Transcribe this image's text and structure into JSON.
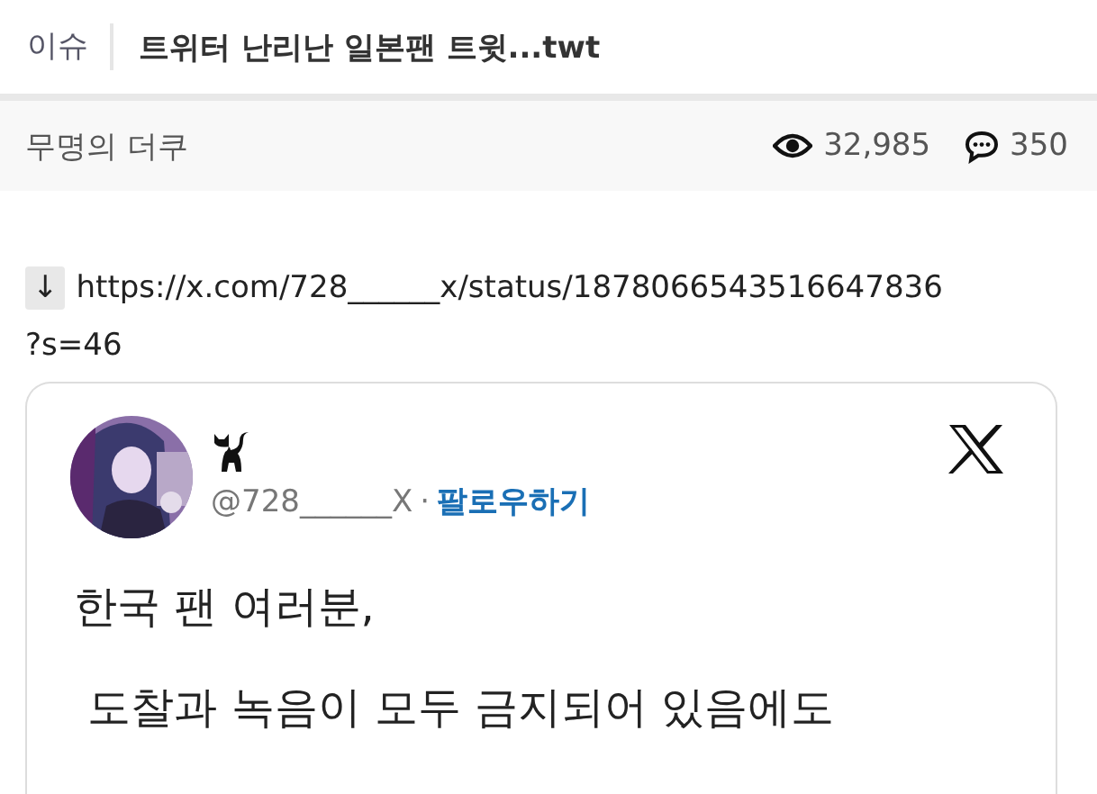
{
  "header": {
    "category": "이슈",
    "title": "트위터 난리난 일본팬 트윗...twt"
  },
  "meta": {
    "author": "무명의 더쿠",
    "views": "32,985",
    "comments": "350"
  },
  "link": {
    "button": "↓",
    "url_lines": [
      "https://x.com/728______x/status/1878066543516647836",
      "?s=46"
    ]
  },
  "tweet": {
    "handle": "@728______X",
    "separator": "·",
    "follow": "팔로우하기",
    "paragraphs": [
      "한국 팬 여러분,",
      " 도찰과 녹음이 모두 금지되어 있음에도"
    ]
  }
}
